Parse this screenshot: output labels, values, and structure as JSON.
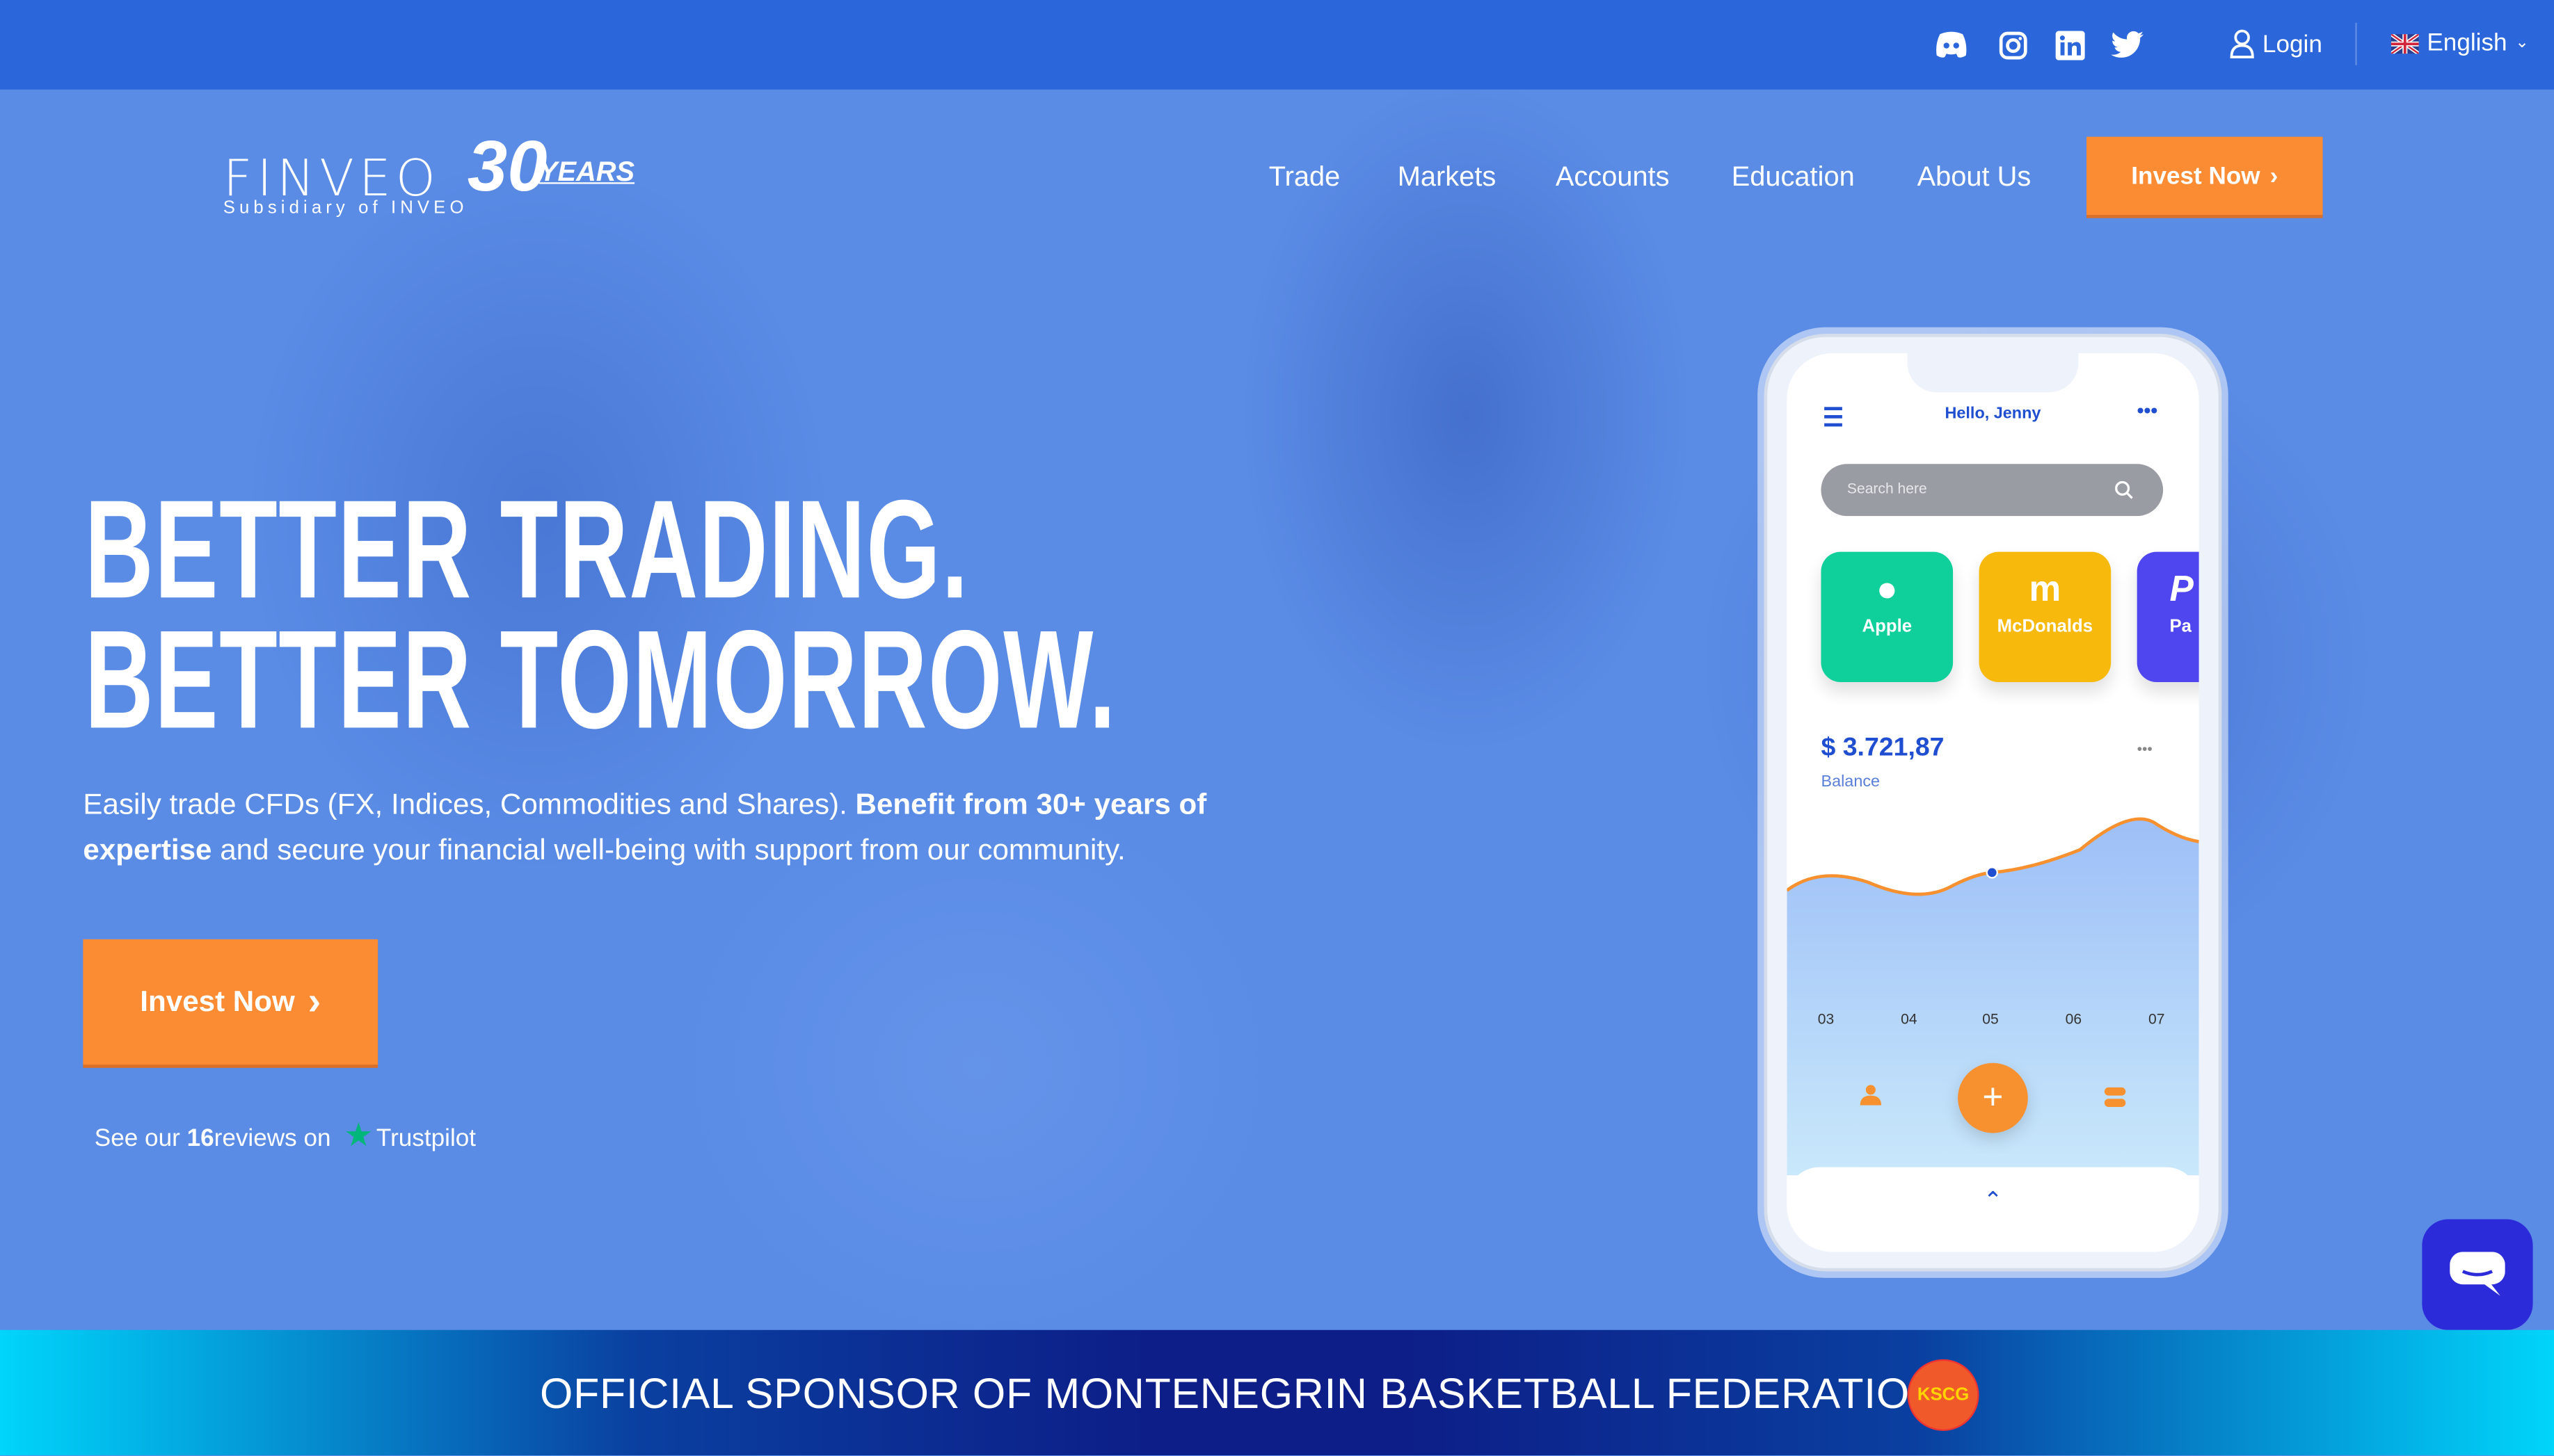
{
  "topbar": {
    "social_icons": [
      "discord-icon",
      "instagram-icon",
      "linkedin-icon",
      "twitter-icon"
    ],
    "login_label": "Login",
    "language": "English"
  },
  "logo": {
    "brand": "FINVEO",
    "badge": "30 YEARS",
    "tagline": "Subsidiary of INVEO"
  },
  "nav": {
    "items": [
      "Trade",
      "Markets",
      "Accounts",
      "Education",
      "About Us"
    ],
    "cta_label": "Invest Now"
  },
  "hero": {
    "headline_1": "BETTER TRADING.",
    "headline_2": "BETTER TOMORROW.",
    "para_regular_1": "Easily trade CFDs (FX, Indices, Commodities and Shares). ",
    "para_bold": "Benefit from 30+ years of expertise",
    "para_regular_2": " and secure your financial well-being with support from our community.",
    "cta_label": "Invest Now",
    "reviews_prefix": "See our ",
    "reviews_count": "16",
    "reviews_suffix": " reviews on",
    "trustpilot": "Trustpilot"
  },
  "phone": {
    "greeting": "Hello, Jenny",
    "search_placeholder": "Search here",
    "tiles": [
      {
        "label": "Apple",
        "color": "#0fcf9b"
      },
      {
        "label": "McDonalds",
        "color": "#f6b90c"
      },
      {
        "label": "Pa",
        "color": "#5046f0"
      }
    ],
    "balance": "$ 3.721,87",
    "balance_label": "Balance",
    "chart_labels": [
      "03",
      "04",
      "05",
      "06",
      "07"
    ]
  },
  "banner": {
    "text": "OFFICIAL SPONSOR OF MONTENEGRIN BASKETBALL FEDERATION",
    "logo_text": "KSCG"
  },
  "colors": {
    "accent": "#fb8c33",
    "topbar": "#2b67da",
    "chat": "#2b2bd9"
  }
}
